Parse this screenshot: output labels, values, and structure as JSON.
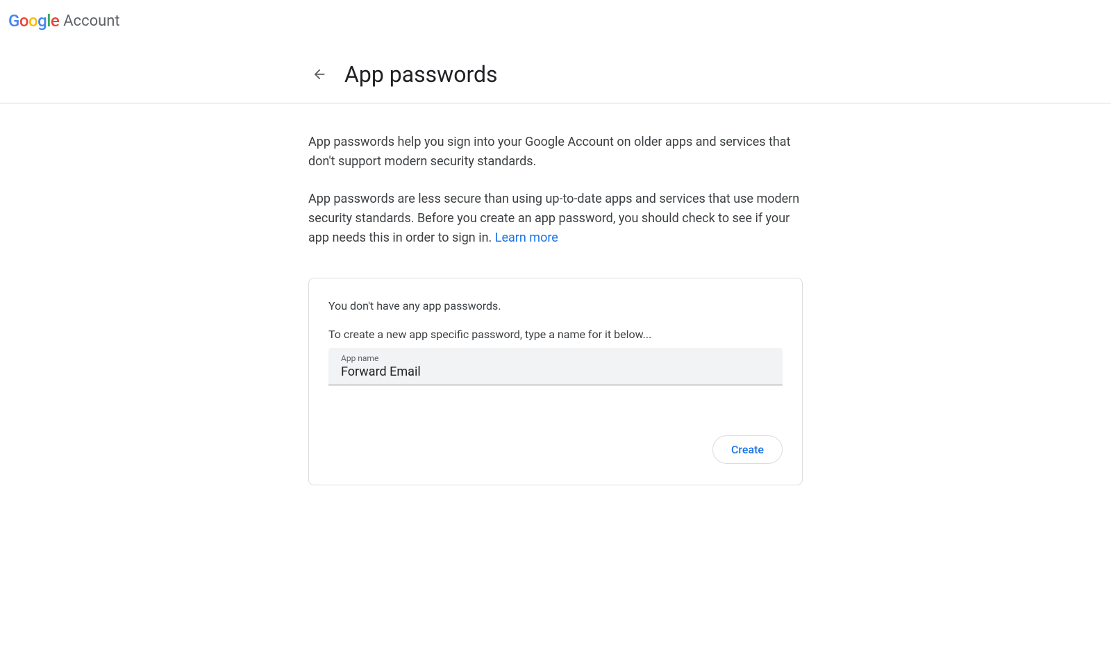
{
  "header": {
    "brand_word": "Account",
    "page_title": "App passwords"
  },
  "intro": {
    "p1": "App passwords help you sign into your Google Account on older apps and services that don't support modern security standards.",
    "p2": "App passwords are less secure than using up-to-date apps and services that use modern security standards. Before you create an app password, you should check to see if your app needs this in order to sign in.",
    "learn_more": "Learn more"
  },
  "card": {
    "status": "You don't have any app passwords.",
    "instruction": "To create a new app specific password, type a name for it below...",
    "field_label": "App name",
    "field_value": "Forward Email",
    "create_label": "Create"
  }
}
